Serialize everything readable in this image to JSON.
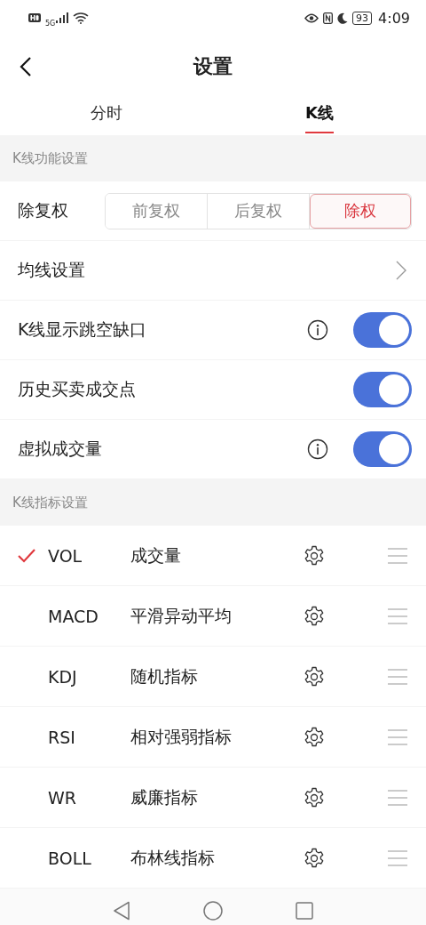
{
  "status_bar": {
    "network": "5G",
    "battery": "93",
    "time": "4:09"
  },
  "header": {
    "title": "设置"
  },
  "tabs": [
    {
      "label": "分时",
      "selected": false
    },
    {
      "label": "K线",
      "selected": true
    }
  ],
  "sections": [
    {
      "title": "K线功能设置",
      "rows": [
        {
          "kind": "segmented",
          "label": "除复权",
          "options": [
            {
              "label": "前复权",
              "selected": false
            },
            {
              "label": "后复权",
              "selected": false
            },
            {
              "label": "除权",
              "selected": true
            }
          ]
        },
        {
          "kind": "link",
          "label": "均线设置"
        },
        {
          "kind": "toggle",
          "label": "K线显示跳空缺口",
          "info": true,
          "on": true
        },
        {
          "kind": "toggle",
          "label": "历史买卖成交点",
          "info": false,
          "on": true
        },
        {
          "kind": "toggle",
          "label": "虚拟成交量",
          "info": true,
          "on": true
        }
      ]
    },
    {
      "title": "K线指标设置",
      "indicators": [
        {
          "code": "VOL",
          "name": "成交量",
          "checked": true
        },
        {
          "code": "MACD",
          "name": "平滑异动平均",
          "checked": false
        },
        {
          "code": "KDJ",
          "name": "随机指标",
          "checked": false
        },
        {
          "code": "RSI",
          "name": "相对强弱指标",
          "checked": false
        },
        {
          "code": "WR",
          "name": "威廉指标",
          "checked": false
        },
        {
          "code": "BOLL",
          "name": "布林线指标",
          "checked": false
        }
      ]
    }
  ]
}
